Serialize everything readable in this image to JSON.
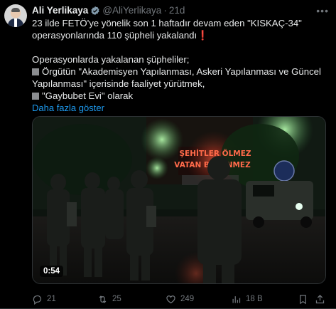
{
  "author": {
    "name": "Ali Yerlikaya",
    "handle": "@AliYerlikaya",
    "separator": "·",
    "time": "21d"
  },
  "tweet": {
    "line1": "23 ilde FETÖ'ye yönelik son 1 haftadır devam eden \"KISKAÇ-34\"",
    "line2": "operasyonlarında 110 şüpheli yakalandı",
    "exclaim": "❗",
    "line3": "Operasyonlarda yakalanan şüpheliler;",
    "line4": "Örgütün \"Akademisyen Yapılanması, Askeri Yapılanması ve Güncel",
    "line5": "Yapılanması\" içerisinde faaliyet yürütmek,",
    "line6": "\"Gaybubet Evi\" olarak",
    "show_more": "Daha fazla göster"
  },
  "media": {
    "duration": "0:54",
    "sign_line1": "ŞEHİTLER ÖLMEZ",
    "sign_line2": "VATAN BÖLÜNMEZ"
  },
  "actions": {
    "replies": "21",
    "retweets": "25",
    "likes": "249",
    "views": "18 B"
  },
  "colors": {
    "background": "#000000",
    "text": "#e7e9ea",
    "muted": "#71767b",
    "link": "#1d9bf0",
    "verified": "#829aab"
  }
}
